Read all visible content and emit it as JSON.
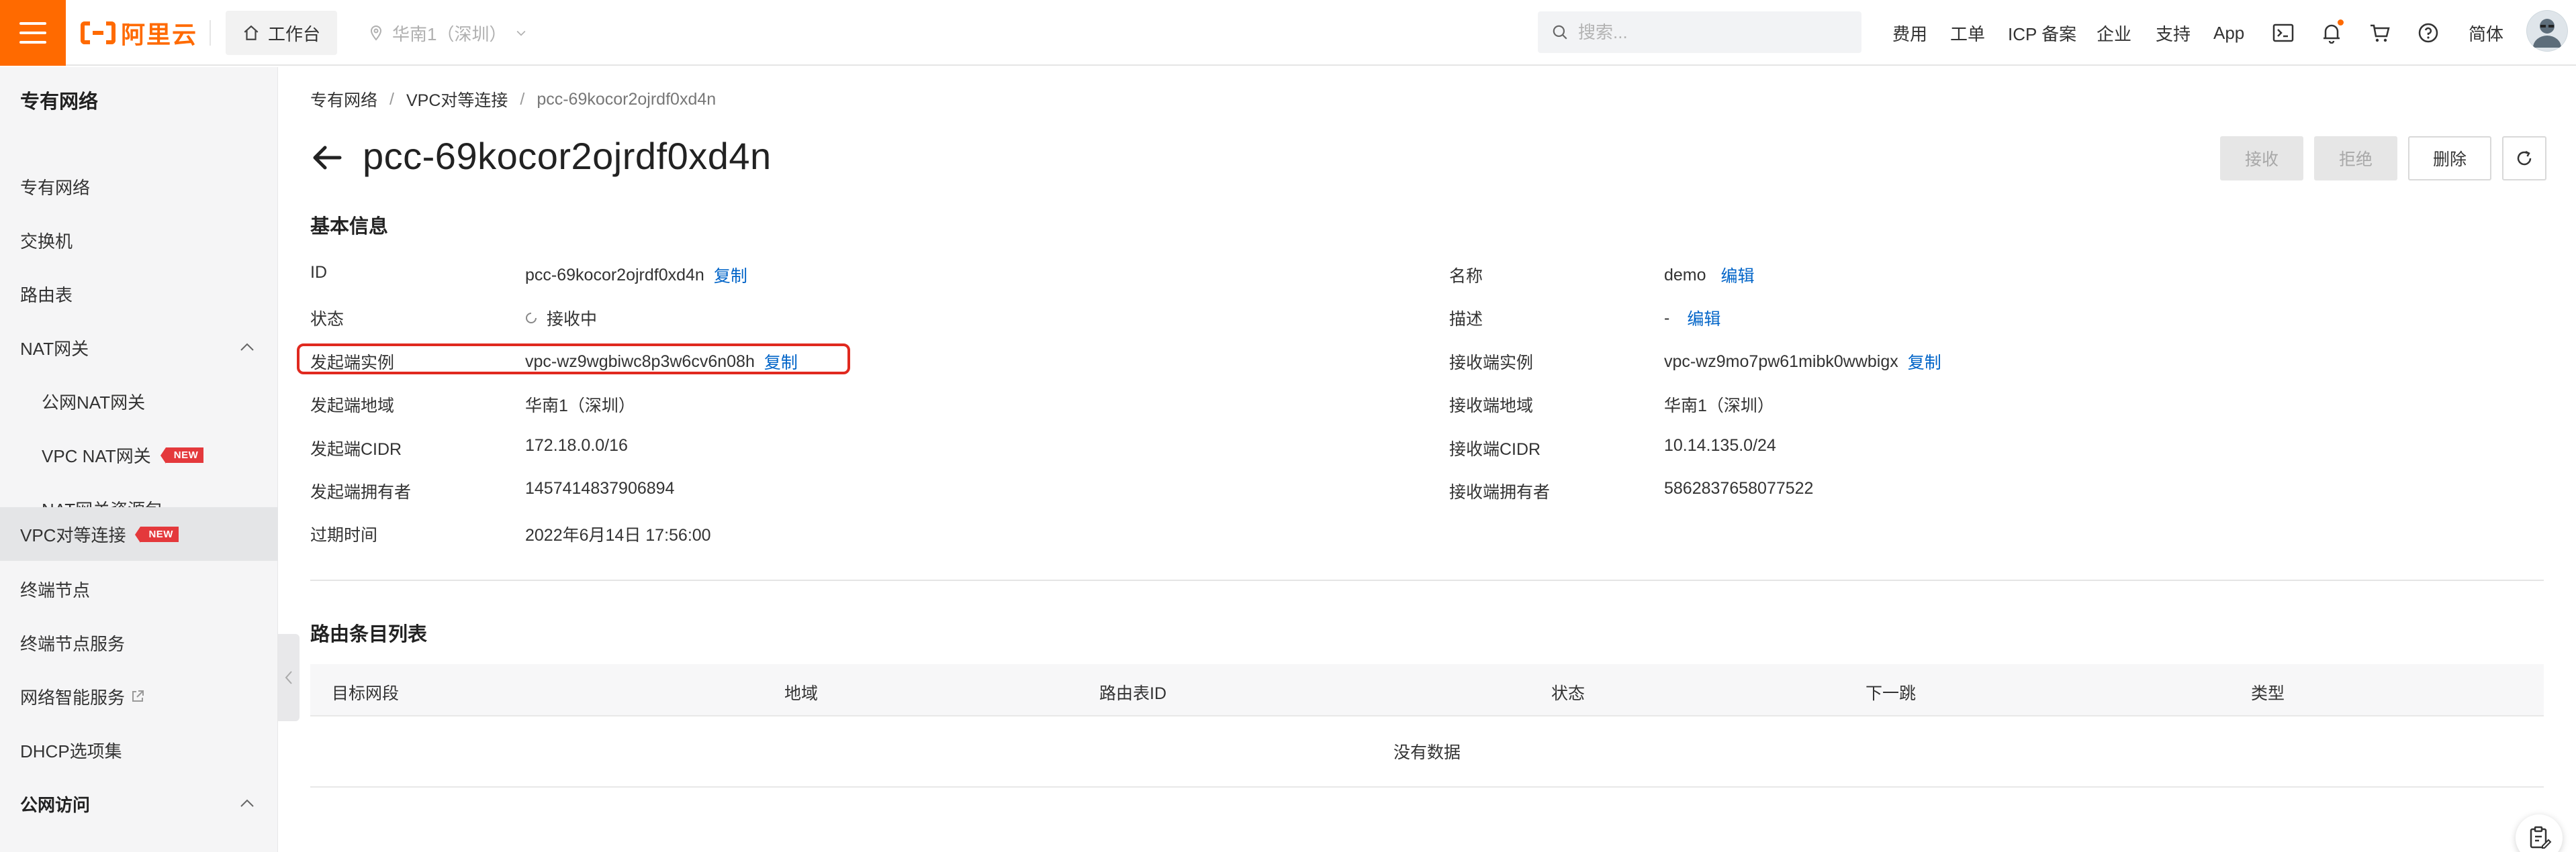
{
  "topbar": {
    "logo_text": "阿里云",
    "workbench_label": "工作台",
    "region_label": "华南1（深圳）",
    "search_placeholder": "搜索...",
    "nav": [
      "费用",
      "工单",
      "ICP 备案",
      "企业",
      "支持",
      "App"
    ],
    "language": "简体",
    "icons": [
      "menu-icon",
      "home-icon",
      "location-icon",
      "chevron-down-icon",
      "search-icon",
      "terminal-icon",
      "bell-icon",
      "cart-icon",
      "help-icon",
      "avatar"
    ],
    "accent_color": "#ff6a00"
  },
  "sidebar": {
    "title": "专有网络",
    "items": [
      {
        "label": "专有网络"
      },
      {
        "label": "交换机"
      },
      {
        "label": "路由表"
      },
      {
        "label": "NAT网关"
      },
      {
        "label": "公网NAT网关"
      },
      {
        "label": "VPC NAT网关",
        "badge": "NEW"
      },
      {
        "label": "NAT网关资源包"
      },
      {
        "label": "VPC对等连接",
        "badge": "NEW"
      },
      {
        "label": "终端节点"
      },
      {
        "label": "终端节点服务"
      },
      {
        "label": "网络智能服务"
      },
      {
        "label": "DHCP选项集"
      },
      {
        "label": "公网访问"
      }
    ],
    "active_item": "VPC对等连接",
    "badge_color": "#e4393c"
  },
  "breadcrumb": [
    "专有网络",
    "VPC对等连接",
    "pcc-69kocor2ojrdf0xd4n"
  ],
  "page": {
    "title": "pcc-69kocor2ojrdf0xd4n",
    "buttons": {
      "accept": "接收",
      "reject": "拒绝",
      "delete": "删除"
    }
  },
  "basic_info": {
    "section_title": "基本信息",
    "copy_label": "复制",
    "edit_label": "编辑",
    "left": [
      {
        "label": "ID",
        "value": "pcc-69kocor2ojrdf0xd4n"
      },
      {
        "label": "状态",
        "value": "接收中"
      },
      {
        "label": "发起端实例",
        "value": "vpc-wz9wgbiwc8p3w6cv6n08h"
      },
      {
        "label": "发起端地域",
        "value": "华南1（深圳）"
      },
      {
        "label": "发起端CIDR",
        "value": "172.18.0.0/16"
      },
      {
        "label": "发起端拥有者",
        "value": "1457414837906894"
      },
      {
        "label": "过期时间",
        "value": "2022年6月14日 17:56:00"
      }
    ],
    "right": [
      {
        "label": "名称",
        "value": "demo"
      },
      {
        "label": "描述",
        "value": "-"
      },
      {
        "label": "接收端实例",
        "value": "vpc-wz9mo7pw61mibk0wwbigx"
      },
      {
        "label": "接收端地域",
        "value": "华南1（深圳）"
      },
      {
        "label": "接收端CIDR",
        "value": "10.14.135.0/24"
      },
      {
        "label": "接收端拥有者",
        "value": "5862837658077522"
      }
    ],
    "highlight_color": "#e0291f",
    "link_color": "#0064c8"
  },
  "route_table": {
    "section_title": "路由条目列表",
    "columns": [
      "目标网段",
      "地域",
      "路由表ID",
      "状态",
      "下一跳",
      "类型"
    ],
    "empty_text": "没有数据"
  }
}
